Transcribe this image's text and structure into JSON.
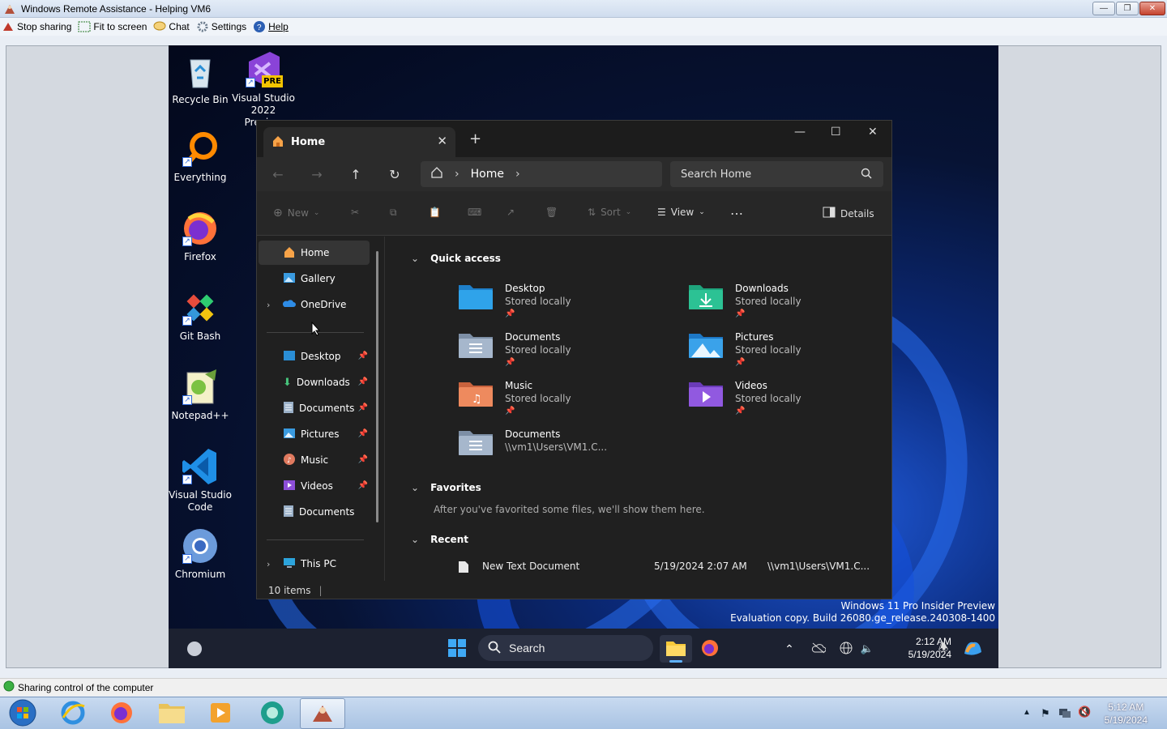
{
  "ra": {
    "title": "Windows Remote Assistance - Helping VM6",
    "toolbar": {
      "stop_sharing": "Stop sharing",
      "fit_to_screen": "Fit to screen",
      "chat": "Chat",
      "settings": "Settings",
      "help": "Help"
    },
    "status": "Sharing control of the computer"
  },
  "desktop": {
    "icons": [
      {
        "label": "Recycle Bin",
        "icon": "recycle-bin-icon"
      },
      {
        "label": "Visual Studio 2022 Preview",
        "icon": "visual-studio-icon",
        "badge": "PRE"
      },
      {
        "label": "Everything",
        "icon": "everything-icon"
      },
      {
        "label": "Firefox",
        "icon": "firefox-icon"
      },
      {
        "label": "Git Bash",
        "icon": "git-bash-icon"
      },
      {
        "label": "Notepad++",
        "icon": "notepad-plus-plus-icon"
      },
      {
        "label": "Visual Studio Code",
        "icon": "vscode-icon"
      },
      {
        "label": "Chromium",
        "icon": "chromium-icon"
      }
    ],
    "watermark_line1": "Windows 11 Pro Insider Preview",
    "watermark_line2": "Evaluation copy. Build 26080.ge_release.240308-1400"
  },
  "explorer": {
    "tab_title": "Home",
    "address_crumb": "Home",
    "search_placeholder": "Search Home",
    "cmd": {
      "new": "New",
      "sort": "Sort",
      "view": "View",
      "details": "Details"
    },
    "nav": {
      "home": "Home",
      "gallery": "Gallery",
      "onedrive": "OneDrive",
      "desktop": "Desktop",
      "downloads": "Downloads",
      "documents": "Documents",
      "pictures": "Pictures",
      "music": "Music",
      "videos": "Videos",
      "documents2": "Documents",
      "thispc": "This PC"
    },
    "sections": {
      "quick_access": "Quick access",
      "favorites": "Favorites",
      "recent": "Recent"
    },
    "quick_access": [
      {
        "name": "Desktop",
        "sub": "Stored locally"
      },
      {
        "name": "Downloads",
        "sub": "Stored locally"
      },
      {
        "name": "Documents",
        "sub": "Stored locally"
      },
      {
        "name": "Pictures",
        "sub": "Stored locally"
      },
      {
        "name": "Music",
        "sub": "Stored locally"
      },
      {
        "name": "Videos",
        "sub": "Stored locally"
      },
      {
        "name": "Documents",
        "sub": "\\\\vm1\\Users\\VM1.C..."
      }
    ],
    "favorites_empty": "After you've favorited some files, we'll show them here.",
    "recent": [
      {
        "name": "New Text Document",
        "date": "5/19/2024 2:07 AM",
        "location": "\\\\vm1\\Users\\VM1.C..."
      }
    ],
    "item_count": "10 items"
  },
  "w11_taskbar": {
    "search": "Search",
    "time": "2:12 AM",
    "date": "5/19/2024"
  },
  "w7_taskbar": {
    "time": "5:12 AM",
    "date": "5/19/2024"
  }
}
